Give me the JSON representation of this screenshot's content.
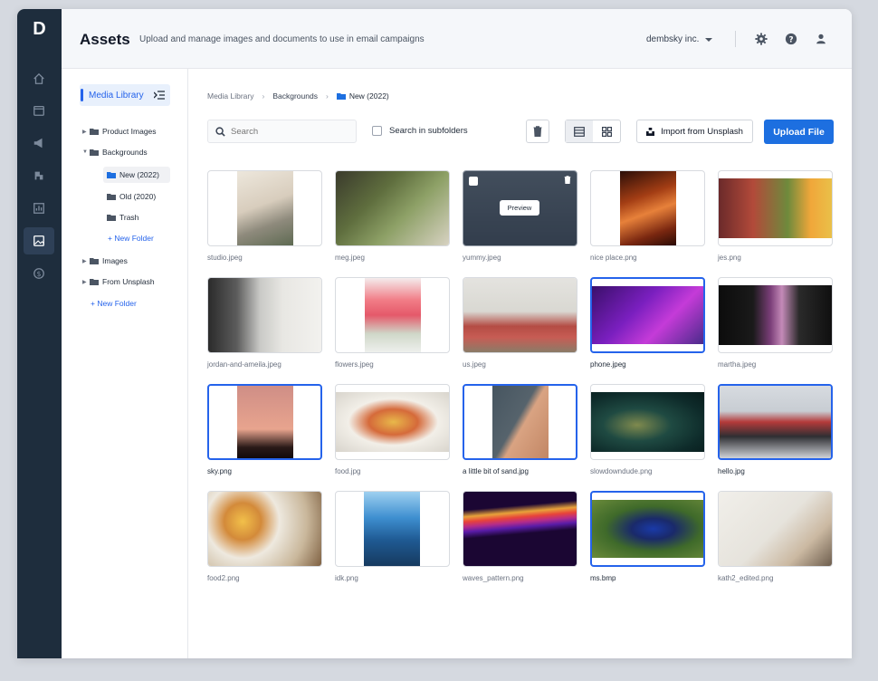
{
  "app": {
    "logo": "D",
    "title": "Assets",
    "subtitle": "Upload and manage images and documents to use in email campaigns",
    "org": "dembsky inc."
  },
  "rail": [
    "home-icon",
    "calendar-icon",
    "megaphone-icon",
    "pipe-icon",
    "chart-icon",
    "image-icon",
    "dollar-icon"
  ],
  "tree": {
    "root": "Media Library",
    "product_images": "Product Images",
    "backgrounds": "Backgrounds",
    "new2022": "New (2022)",
    "old2020": "Old (2020)",
    "trash": "Trash",
    "new_folder_inner": "+ New Folder",
    "images": "Images",
    "from_unsplash": "From Unsplash",
    "new_folder": "+ New Folder"
  },
  "breadcrumb": {
    "a": "Media Library",
    "b": "Backgrounds",
    "c": "New (2022)"
  },
  "toolbar": {
    "search_placeholder": "Search",
    "subfolders": "Search in subfolders",
    "unsplash": "Import from Unsplash",
    "upload": "Upload File"
  },
  "hover": {
    "preview": "Preview"
  },
  "files": [
    {
      "name": "studio.jpeg",
      "selected": false
    },
    {
      "name": "meg.jpeg",
      "selected": false
    },
    {
      "name": "yummy.jpeg",
      "selected": false
    },
    {
      "name": "nice place.png",
      "selected": false
    },
    {
      "name": "jes.png",
      "selected": false
    },
    {
      "name": "jordan-and-ameila.jpeg",
      "selected": false
    },
    {
      "name": "flowers.jpeg",
      "selected": false
    },
    {
      "name": "us.jpeg",
      "selected": false
    },
    {
      "name": "phone.jpeg",
      "selected": true
    },
    {
      "name": "martha.jpeg",
      "selected": false
    },
    {
      "name": "sky.png",
      "selected": true
    },
    {
      "name": "food.jpg",
      "selected": false
    },
    {
      "name": "a little bit of sand.jpg",
      "selected": true
    },
    {
      "name": "slowdowndude.png",
      "selected": false
    },
    {
      "name": "hello.jpg",
      "selected": true
    },
    {
      "name": "food2.png",
      "selected": false
    },
    {
      "name": "idk.png",
      "selected": false
    },
    {
      "name": "waves_pattern.png",
      "selected": false
    },
    {
      "name": "ms.bmp",
      "selected": true
    },
    {
      "name": "kath2_edited.png",
      "selected": false
    }
  ],
  "colors": {
    "accent": "#1d6fe0",
    "rail": "#1e2d3d"
  }
}
